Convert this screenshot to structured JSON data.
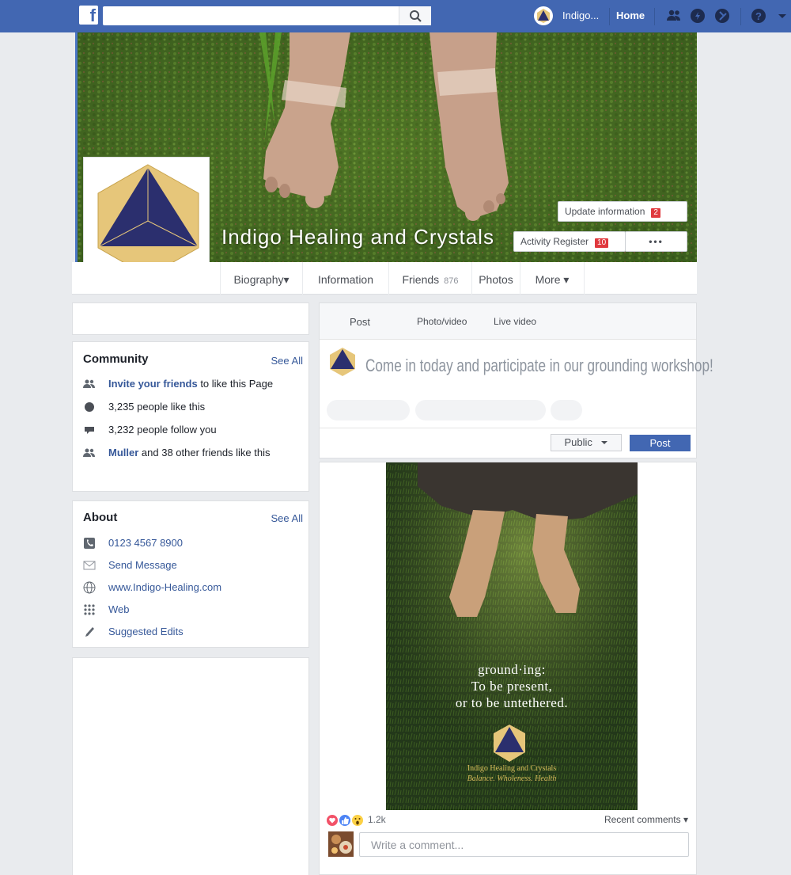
{
  "topbar": {
    "logo": "f",
    "search_placeholder": "",
    "user_name": "Indigo...",
    "home": "Home",
    "icons": [
      "search-icon",
      "friends-icon",
      "messenger-icon",
      "notifications-icon",
      "help-icon"
    ]
  },
  "cover": {
    "page_name": "Indigo Healing and Crystals",
    "update_info_label": "Update information",
    "update_info_count": "2",
    "activity_label": "Activity Register",
    "activity_count": "10",
    "more_dots": "•••"
  },
  "nav": {
    "tabs": [
      {
        "label": "Biography▾"
      },
      {
        "label": "Information"
      },
      {
        "label": "Friends",
        "count": "876"
      },
      {
        "label": "Photos"
      },
      {
        "label": "More ▾"
      }
    ]
  },
  "community": {
    "title": "Community",
    "see_all": "See All",
    "invite_link": "Invite your friends",
    "invite_rest": " to like this Page",
    "likes": "3,235 people like this",
    "follows": "3,232 people follow you",
    "friend_name": "Muller",
    "friend_rest": " and 38 other friends like this"
  },
  "about": {
    "title": "About",
    "see_all": "See All",
    "phone": "0123 4567 8900",
    "message": "Send Message",
    "website": "www.Indigo-Healing.com",
    "web": "Web",
    "suggested": "Suggested Edits"
  },
  "composer": {
    "tabs": [
      "Post",
      "Photo/video",
      "Live video"
    ],
    "text": "Come in today and participate in our grounding workshop!",
    "privacy": "Public",
    "post_button": "Post"
  },
  "post": {
    "image_line1": "ground·ing:",
    "image_line2": "To be present,",
    "image_line3": "or to be untethered.",
    "image_brand": "Indigo Healing and Crystals",
    "image_tagline": "Balance. Wholeness. Health",
    "reaction_count": "1.2k",
    "recent_comments": "Recent comments ▾",
    "comment_placeholder": "Write a comment..."
  },
  "colors": {
    "brand_blue": "#4267b2",
    "logo_navy": "#2b2f6e",
    "logo_gold": "#e6c67a"
  }
}
